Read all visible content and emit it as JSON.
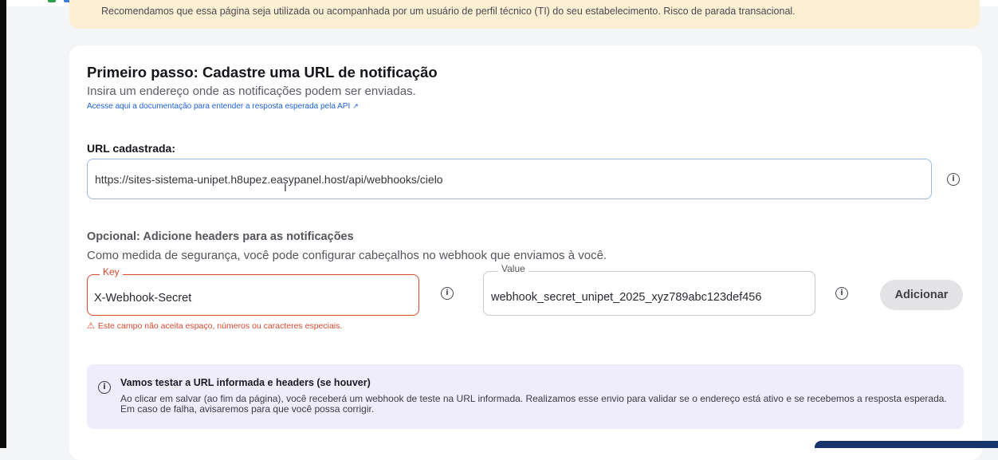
{
  "colors": {
    "warning_bg": "#fcefd3",
    "card_bg": "#ffffff",
    "page_bg": "#f4f5f7",
    "link": "#1f60d6",
    "error": "#d8492f",
    "info_bg": "#efecfc",
    "primary_dark": "#17356b"
  },
  "warning": {
    "text": "Recomendamos que essa página seja utilizada ou acompanhada por um usuário de perfil técnico (TI) do seu estabelecimento. Risco de parada transacional."
  },
  "step": {
    "title": "Primeiro passo: Cadastre uma URL de notificação",
    "subtitle": "Insira um endereço onde as notificações podem ser enviadas.",
    "doc_link": "Acesse aqui a documentação para entender a resposta esperada pela API",
    "doc_link_icon": "external-link-icon"
  },
  "url": {
    "label": "URL cadastrada:",
    "value": "https://sites-sistema-unipet.h8upez.easypanel.host/api/webhooks/cielo",
    "info_icon": "info-icon"
  },
  "headers": {
    "title": "Opcional: Adicione headers para as notificações",
    "description": "Como medida de segurança, você pode configurar cabeçalhos no webhook que enviamos à você.",
    "key": {
      "label": "Key",
      "value": "X-Webhook-Secret",
      "error": "Este campo não aceita espaço, números ou caracteres especiais.",
      "error_icon": "warning-icon"
    },
    "value": {
      "label": "Value",
      "value": "webhook_secret_unipet_2025_xyz789abc123def456"
    },
    "add_button": "Adicionar"
  },
  "test_notice": {
    "icon": "info-icon",
    "title": "Vamos testar a URL informada e headers (se houver)",
    "body": "Ao clicar em salvar (ao fim da página), você receberá um webhook de teste na URL informada. Realizamos esse envio para validar se o endereço está ativo e se recebemos a resposta esperada. Em caso de falha, avisaremos para que você possa corrigir."
  }
}
